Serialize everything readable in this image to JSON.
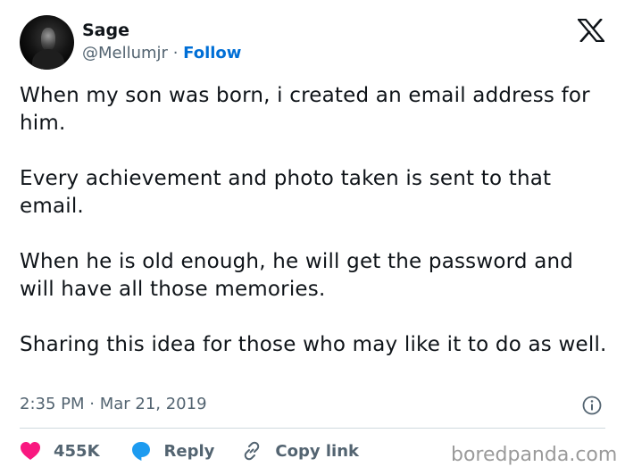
{
  "author": {
    "name": "Sage",
    "handle": "@Mellumjr",
    "separator": "·",
    "follow_label": "Follow"
  },
  "tweet": {
    "paragraphs": [
      "When my son was born, i created an email address for him.",
      "Every achievement and photo taken is sent to that email.",
      "When he is old enough, he will get the password and will have all those memories.",
      "Sharing this idea for those who may like it to do as well."
    ],
    "timestamp": "2:35 PM · Mar 21, 2019"
  },
  "actions": {
    "likes_count": "455K",
    "reply_label": "Reply",
    "copy_link_label": "Copy link"
  },
  "icons": {
    "logo": "x-logo",
    "info": "info-icon",
    "like": "heart-icon",
    "reply": "speech-bubble-icon",
    "copy": "link-icon"
  },
  "colors": {
    "text": "#0f1419",
    "secondary": "#536471",
    "follow": "#006fd6",
    "heart": "#f91880",
    "reply": "#1d9bf0",
    "divider": "#cfd9de"
  },
  "watermark": "boredpanda.com"
}
